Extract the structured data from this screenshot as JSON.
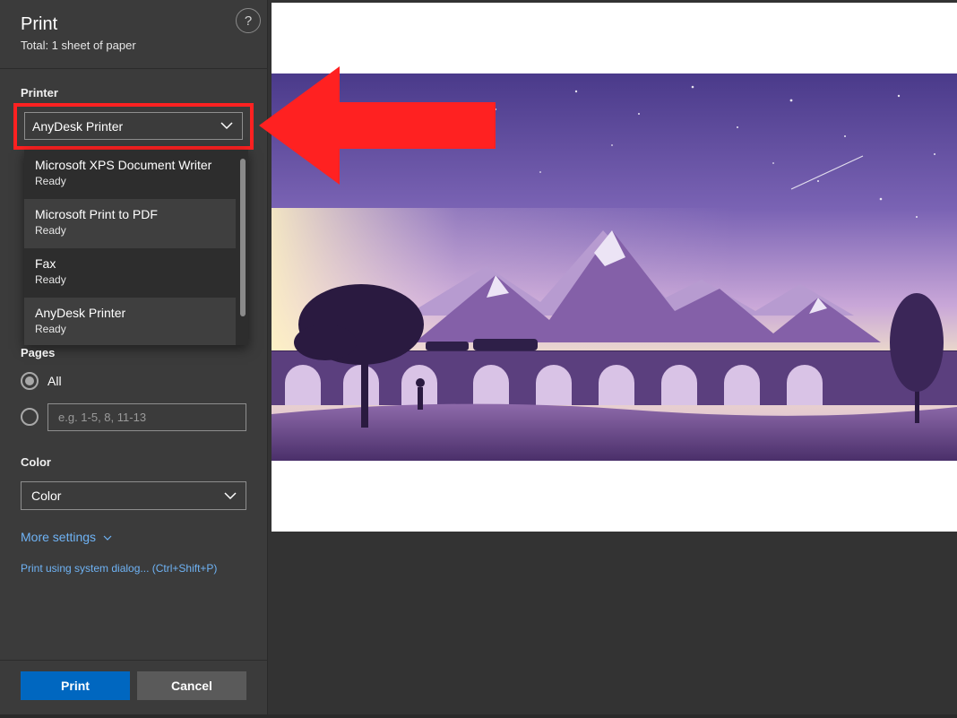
{
  "header": {
    "title": "Print",
    "subtitle": "Total: 1 sheet of paper",
    "help_label": "?"
  },
  "printer": {
    "label": "Printer",
    "selected": "AnyDesk Printer",
    "options": [
      {
        "name": "Microsoft XPS Document Writer",
        "status": "Ready"
      },
      {
        "name": "Microsoft Print to PDF",
        "status": "Ready"
      },
      {
        "name": "Fax",
        "status": "Ready"
      },
      {
        "name": "AnyDesk Printer",
        "status": "Ready"
      }
    ]
  },
  "pages": {
    "label": "Pages",
    "all_label": "All",
    "custom_placeholder": "e.g. 1-5, 8, 11-13"
  },
  "color": {
    "label": "Color",
    "selected": "Color"
  },
  "links": {
    "more_settings": "More settings",
    "system_dialog": "Print using system dialog... (Ctrl+Shift+P)"
  },
  "buttons": {
    "print": "Print",
    "cancel": "Cancel"
  },
  "colors": {
    "accent": "#0067c0",
    "link": "#6fb3f5",
    "annotation": "#ff2121",
    "panel": "#3b3b3b"
  }
}
